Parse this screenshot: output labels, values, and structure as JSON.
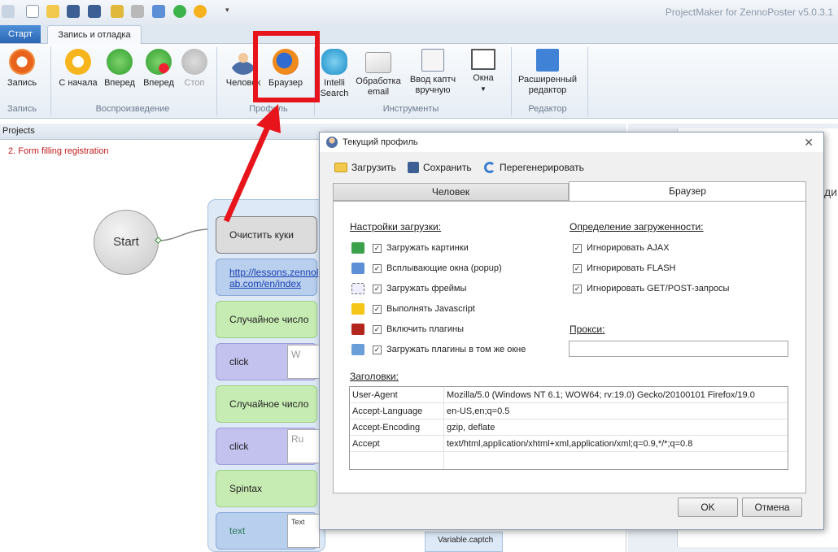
{
  "app": {
    "title": "ProjectMaker for ZennoPoster v5.0.3.1",
    "tabs": {
      "start": "Старт",
      "record": "Запись и отладка"
    }
  },
  "ribbon": {
    "buttons": {
      "record": "Запись",
      "from_start": "С начала",
      "forward1": "Вперед",
      "forward2": "Вперед",
      "stop": "Стоп",
      "human": "Человек",
      "browser": "Браузер",
      "intelli1": "Intelli",
      "intelli2": "Search",
      "email1": "Обработка",
      "email2": "email",
      "captcha1": "Ввод каптч",
      "captcha2": "вручную",
      "windows": "Окна",
      "editor1": "Расширенный",
      "editor2": "редактор"
    },
    "groups": {
      "record": "Запись",
      "playback": "Воспроизведение",
      "profile": "Профиль",
      "tools": "Инструменты",
      "editor": "Редактор"
    }
  },
  "projects": {
    "header": "Projects",
    "name": "2. Form filling registration"
  },
  "flow": {
    "start": "Start",
    "nodes": [
      "Очистить куки",
      "http://lessons.zennolab.com/en/index",
      "Случайное число",
      "click",
      "Случайное число",
      "click",
      "Spintax",
      "text"
    ],
    "node_url_l1": "http://lessons.zennol",
    "node_url_l2": "ab.com/en/index",
    "details": [
      "W",
      "Ru",
      "Text"
    ],
    "bottom_var": "Variable.captch"
  },
  "right_fragment": "ди",
  "dialog": {
    "title": "Текущий профиль",
    "toolbar": {
      "load": "Загрузить",
      "save": "Сохранить",
      "regen": "Перегенерировать"
    },
    "tabs": {
      "human": "Человек",
      "browser": "Браузер"
    },
    "load_settings": {
      "title": "Настройки загрузки:",
      "items": [
        "Загружать картинки",
        "Всплывающие окна (popup)",
        "Загружать фреймы",
        "Выполнять Javascript",
        "Включить плагины",
        "Загружать плагины в том же окне"
      ]
    },
    "busy": {
      "title": "Определение загруженности:",
      "items": [
        "Игнорировать AJAX",
        "Игнорировать FLASH",
        "Игнорировать GET/POST-запросы"
      ]
    },
    "proxy_label": "Прокси:",
    "headers": {
      "title": "Заголовки:",
      "rows": [
        {
          "key": "User-Agent",
          "value": "Mozilla/5.0 (Windows NT 6.1; WOW64; rv:19.0) Gecko/20100101 Firefox/19.0"
        },
        {
          "key": "Accept-Language",
          "value": "en-US,en;q=0.5"
        },
        {
          "key": "Accept-Encoding",
          "value": "gzip, deflate"
        },
        {
          "key": "Accept",
          "value": "text/html,application/xhtml+xml,application/xml;q=0.9,*/*;q=0.8"
        }
      ]
    },
    "ok": "OK",
    "cancel": "Отмена"
  },
  "colors": {
    "highlight": "#e8141c",
    "accent": "#2a66b4"
  }
}
